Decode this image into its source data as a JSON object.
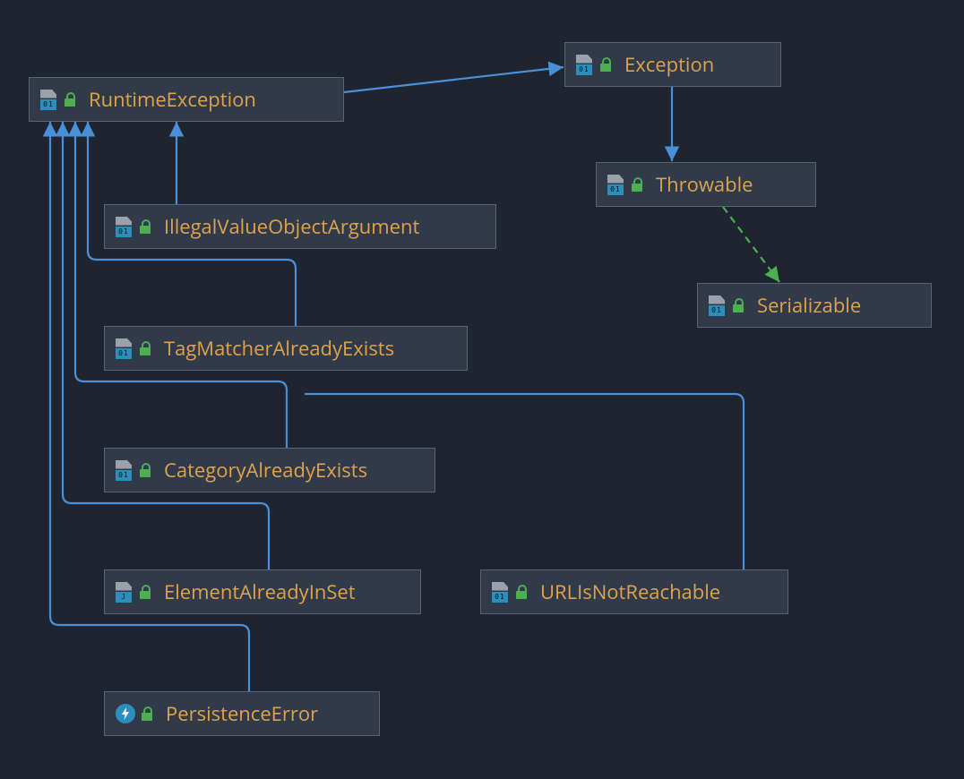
{
  "nodes": {
    "runtimeException": {
      "label": "RuntimeException",
      "iconText": "01",
      "iconKind": "file"
    },
    "exception": {
      "label": "Exception",
      "iconText": "01",
      "iconKind": "file"
    },
    "throwable": {
      "label": "Throwable",
      "iconText": "01",
      "iconKind": "file"
    },
    "serializable": {
      "label": "Serializable",
      "iconText": "01",
      "iconKind": "file"
    },
    "illegalValueObjectArgument": {
      "label": "IllegalValueObjectArgument",
      "iconText": "01",
      "iconKind": "file"
    },
    "tagMatcherAlreadyExists": {
      "label": "TagMatcherAlreadyExists",
      "iconText": "01",
      "iconKind": "file"
    },
    "categoryAlreadyExists": {
      "label": "CategoryAlreadyExists",
      "iconText": "01",
      "iconKind": "file"
    },
    "elementAlreadyInSet": {
      "label": "ElementAlreadyInSet",
      "iconText": "J",
      "iconKind": "file"
    },
    "urlIsNotReachable": {
      "label": "URLIsNotReachable",
      "iconText": "01",
      "iconKind": "file"
    },
    "persistenceError": {
      "label": "PersistenceError",
      "iconText": "",
      "iconKind": "bolt"
    }
  },
  "colors": {
    "nodeBg": "#313a48",
    "nodeBorder": "#5b6472",
    "labelText": "#e0a24b",
    "arrowBlue": "#4a90d9",
    "arrowGreen": "#4caf50",
    "canvasBg": "#1e2430"
  },
  "edges": [
    {
      "from": "runtimeException",
      "to": "exception",
      "style": "solid-blue"
    },
    {
      "from": "exception",
      "to": "throwable",
      "style": "solid-blue"
    },
    {
      "from": "throwable",
      "to": "serializable",
      "style": "dashed-green"
    },
    {
      "from": "illegalValueObjectArgument",
      "to": "runtimeException",
      "style": "solid-blue"
    },
    {
      "from": "tagMatcherAlreadyExists",
      "to": "runtimeException",
      "style": "solid-blue"
    },
    {
      "from": "categoryAlreadyExists",
      "to": "runtimeException",
      "style": "solid-blue"
    },
    {
      "from": "elementAlreadyInSet",
      "to": "runtimeException",
      "style": "solid-blue"
    },
    {
      "from": "urlIsNotReachable",
      "to": "runtimeException",
      "style": "solid-blue"
    },
    {
      "from": "persistenceError",
      "to": "runtimeException",
      "style": "solid-blue"
    }
  ]
}
